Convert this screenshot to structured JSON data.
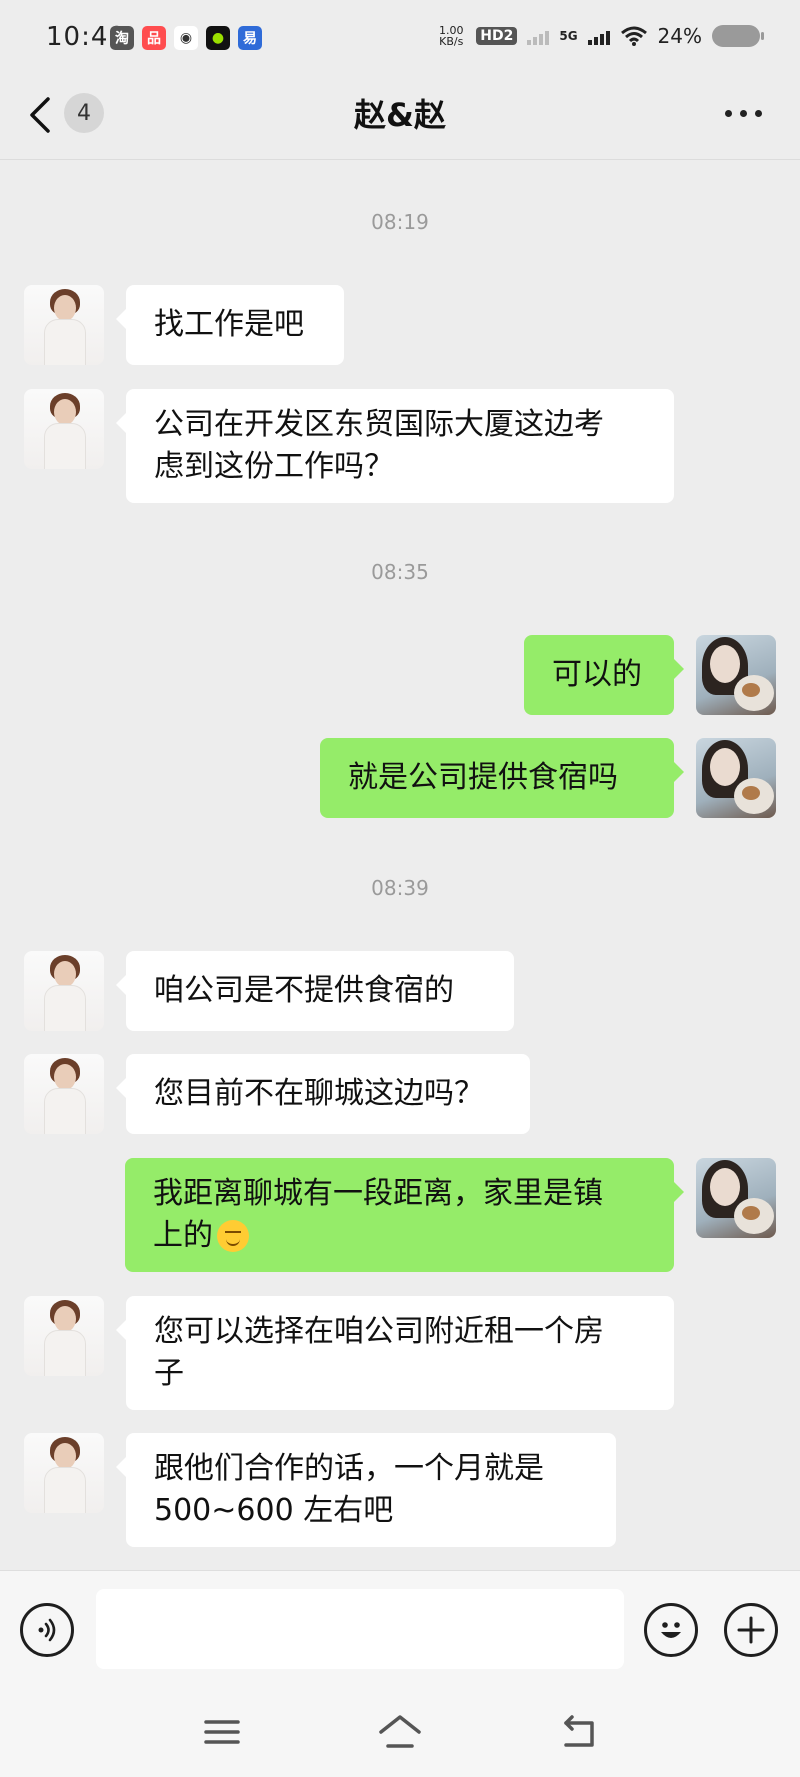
{
  "status_bar": {
    "time": "10:40",
    "apps": [
      {
        "icon": "taobao-icon",
        "glyph": "淘",
        "color": "#555555"
      },
      {
        "icon": "app-red-icon",
        "glyph": "品",
        "color": "#ff4d4f"
      },
      {
        "icon": "weibo-icon",
        "glyph": "◉",
        "color": "#333333"
      },
      {
        "icon": "app-green-icon",
        "glyph": "●",
        "color": "#111111"
      },
      {
        "icon": "app-blue-icon",
        "glyph": "易",
        "color": "#2f6bd8"
      }
    ],
    "speed": "1.00",
    "speed_unit": "KB/s",
    "hd": "HD2",
    "network": "5G",
    "battery": "24%"
  },
  "header": {
    "back_label": "<",
    "unread_count": "4",
    "title": "赵&赵",
    "more_icon": "more-icon"
  },
  "messages": {
    "ts1": "08:19",
    "m1": "找工作是吧",
    "m2_line1": "公司在开发区东贸国际大厦这边考",
    "m2_line2": "虑到这份工作吗？",
    "ts2": "08:35",
    "m3": "可以的",
    "m4": "就是公司提供食宿吗",
    "ts3": "08:39",
    "m5": "咱公司是不提供食宿的",
    "m6": "您目前不在聊城这边吗？",
    "m7_line1": "我距离聊城有一段距离，家里是镇",
    "m7_line2": "上的",
    "m8_line1": "您可以选择在咱公司附近租一个房",
    "m8_line2": "子",
    "m9_line1": "跟他们合作的话，一个月就是",
    "m9_line2": "500~600 左右吧"
  },
  "input_bar": {
    "voice_icon": "voice-icon",
    "emoji_icon": "emoji-icon",
    "plus_icon": "plus-icon",
    "placeholder": ""
  },
  "colors": {
    "background": "#ededed",
    "incoming_bubble": "#ffffff",
    "outgoing_bubble": "#95ec69"
  }
}
